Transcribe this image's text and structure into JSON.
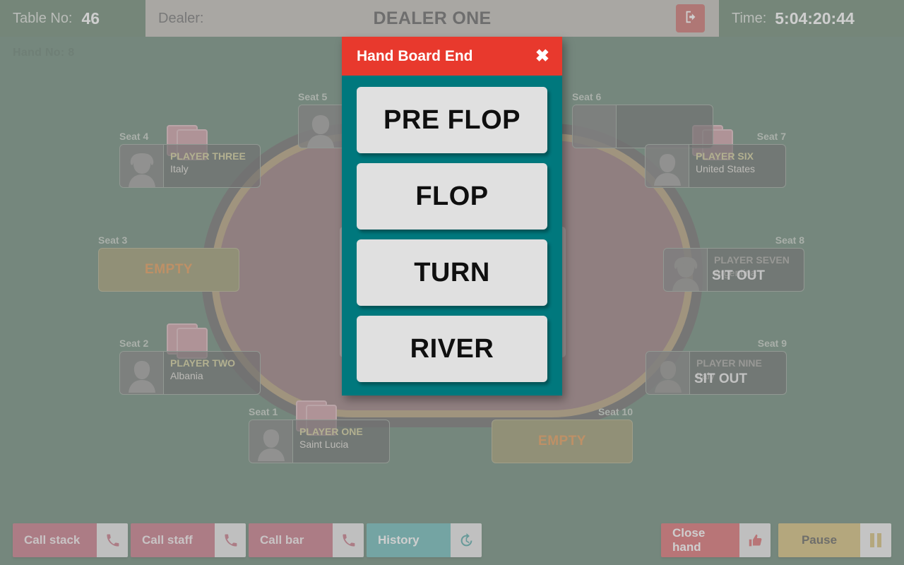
{
  "header": {
    "table_no_label": "Table No:",
    "table_no_value": "46",
    "dealer_label": "Dealer:",
    "dealer_name": "DEALER ONE",
    "logout_icon": "logout-icon",
    "time_label": "Time:",
    "time_value": "5:04:20:44"
  },
  "board": {
    "hand_no": "Hand No: 8"
  },
  "seats": [
    {
      "label": "Seat 1",
      "state": "occupied",
      "name": "PLAYER ONE",
      "country": "Saint Lucia",
      "avatar": "male"
    },
    {
      "label": "Seat 2",
      "state": "occupied",
      "name": "PLAYER TWO",
      "country": "Albania",
      "avatar": "male"
    },
    {
      "label": "Seat 3",
      "state": "empty",
      "empty_text": "EMPTY"
    },
    {
      "label": "Seat 4",
      "state": "occupied",
      "name": "PLAYER THREE",
      "country": "Italy",
      "avatar": "female"
    },
    {
      "label": "Seat 5",
      "state": "occupied",
      "name": "",
      "country": "",
      "avatar": "female"
    },
    {
      "label": "Seat 6",
      "state": "occupied",
      "name": "",
      "country": "",
      "avatar": "none"
    },
    {
      "label": "Seat 7",
      "state": "occupied",
      "name": "PLAYER SIX",
      "country": "United States",
      "avatar": "male"
    },
    {
      "label": "Seat 8",
      "state": "sitout",
      "name": "PLAYER SEVEN",
      "country": "Argentina",
      "avatar": "female",
      "status": "SIT OUT"
    },
    {
      "label": "Seat 9",
      "state": "sitout",
      "name": "PLAYER NINE",
      "country": "Italy",
      "avatar": "male",
      "status": "SIT OUT"
    },
    {
      "label": "Seat 10",
      "state": "empty",
      "empty_text": "EMPTY"
    }
  ],
  "toolbar": {
    "call_stack": "Call stack",
    "call_stack_icon": "phone-icon",
    "call_staff": "Call staff",
    "call_staff_icon": "phone-icon",
    "call_bar": "Call bar",
    "call_bar_icon": "phone-icon",
    "history": "History",
    "history_icon": "history-icon",
    "close_hand": "Close hand",
    "close_hand_icon": "thumbs-up-icon",
    "pause": "Pause",
    "pause_icon": "pause-icon"
  },
  "modal": {
    "title": "Hand Board End",
    "close_icon": "close-icon",
    "options": [
      {
        "label": "PRE FLOP"
      },
      {
        "label": "FLOP"
      },
      {
        "label": "TURN"
      },
      {
        "label": "RIVER"
      }
    ]
  },
  "colors": {
    "accent_red": "#e8392d",
    "modal_teal": "#00787d",
    "felt_green": "#577a66",
    "empty_olive": "#8d8a5c",
    "empty_text": "#e08a3c",
    "gold": "#cfb666"
  }
}
